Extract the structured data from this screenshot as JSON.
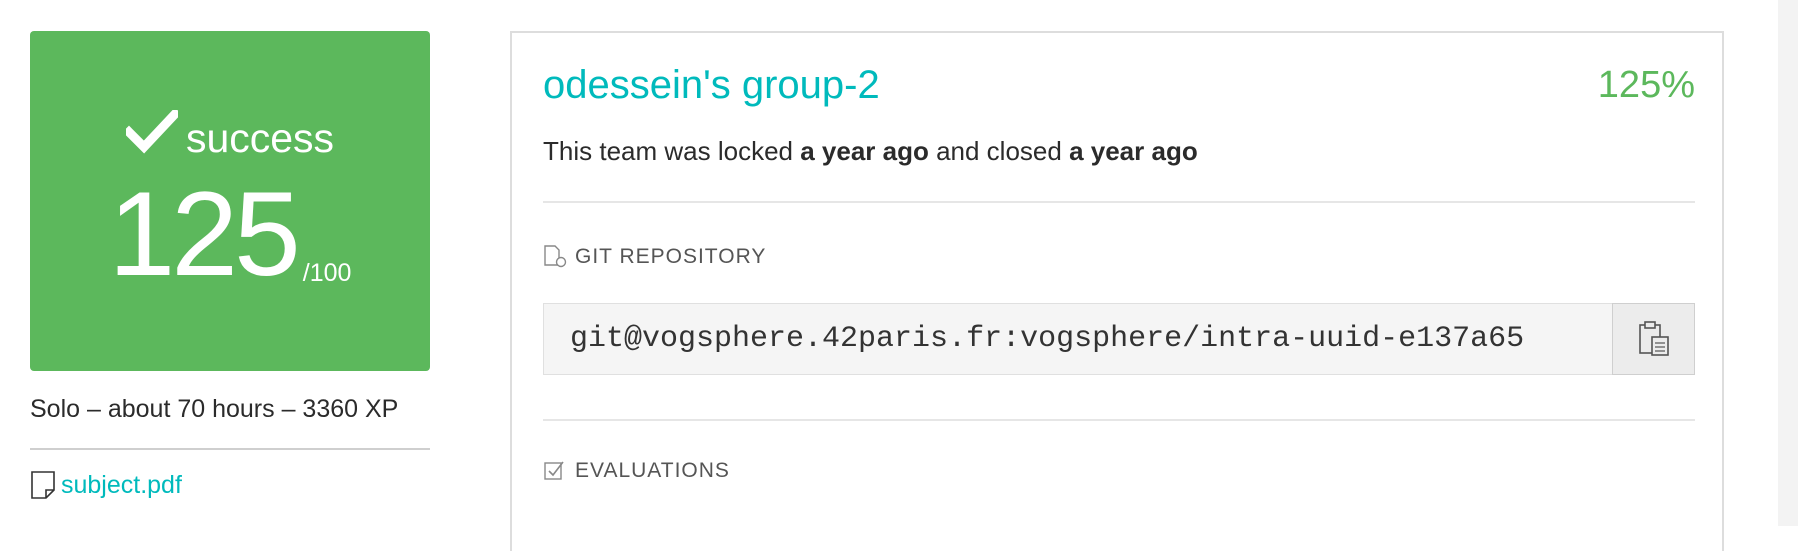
{
  "project": {
    "status": "success",
    "score": "125",
    "score_max": "/100",
    "meta": "Solo – about 70 hours – 3360 XP",
    "subject_link": "subject.pdf"
  },
  "team": {
    "name": "odessein's group-2",
    "percent": "125%",
    "lock_prefix": "This team was locked ",
    "locked_when": "a year ago",
    "lock_middle": " and closed ",
    "closed_when": "a year ago"
  },
  "git": {
    "section_title": "GIT REPOSITORY",
    "url": "git@vogsphere.42paris.fr:vogsphere/intra-uuid-e137a65"
  },
  "evaluations": {
    "section_title": "EVALUATIONS"
  },
  "icons": {
    "status": "check-icon",
    "subject": "file-icon",
    "git": "git-repo-icon",
    "copy": "clipboard-icon",
    "evaluations": "checkbox-icon"
  },
  "colors": {
    "success": "#5cb85c",
    "accent": "#00babc"
  }
}
